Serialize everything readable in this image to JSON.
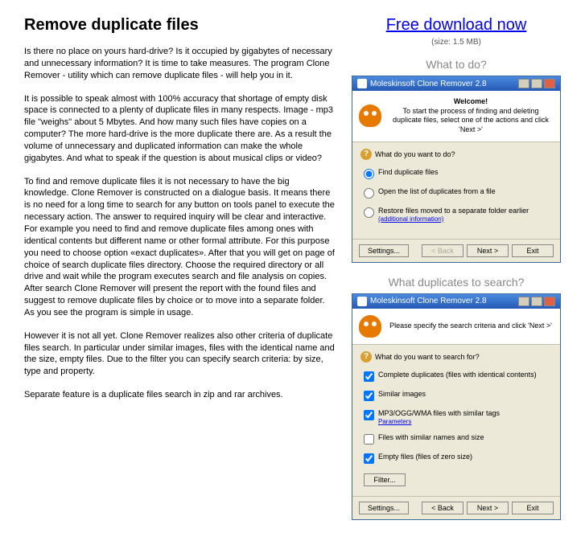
{
  "heading": "Remove duplicate files",
  "paragraphs": [
    "Is there no place on yours hard-drive? Is it occupied by gigabytes of necessary and unnecessary information? It is time to take measures. The program Clone Remover - utility which can remove duplicate files - will help you in it.",
    "It is possible to speak almost with 100% accuracy that shortage of empty disk space is connected to a plenty of duplicate files in many respects. Image - mp3 file \"weighs\" about 5 Mbytes. And how many such files have copies on a computer? The more hard-drive is the more duplicate there are. As a result the volume of unnecessary and duplicated information can make the whole gigabytes. And what to speak if the question is about musical clips or video?",
    "To find and remove duplicate files it is not necessary to have the big knowledge. Clone Remover is constructed on a dialogue basis. It means there is no need for a long time to search for any button on tools panel to execute the necessary action. The answer to required inquiry will be clear and interactive. For example you need to find and remove duplicate files among ones with identical contents but different name or other formal attribute. For this purpose you need to choose option «exact duplicates». After that you will get on page of choice of search duplicate files directory. Choose the required directory or all drive and wait while the program executes search and file analysis on copies. After search Clone Remover will present the report with the found files and suggest to remove duplicate files by choice or to move into a separate folder. As you see the program is simple in usage.",
    "However it is not all yet. Clone Remover realizes also other criteria of duplicate files search. In particular under similar images, files with the identical name and the size, empty files. Due to the filter you can specify search criteria: by size, type and property.",
    "Separate feature is a duplicate files search in zip and rar archives."
  ],
  "download": {
    "label": "Free download now",
    "size": "(size: 1.5 MB)"
  },
  "section1": {
    "title": "What to do?",
    "window_title": "Moleskinsoft Clone Remover 2.8",
    "welcome": "Welcome!",
    "intro": "To start the process of finding and deleting duplicate files, select one of the actions and click 'Next >'",
    "question": "What do you want to do?",
    "opt1": "Find duplicate files",
    "opt2": "Open the list of duplicates from a file",
    "opt3": "Restore files moved to a separate folder earlier",
    "opt3_link": "(additional information)",
    "settings": "Settings...",
    "back": "< Back",
    "next": "Next >",
    "exit": "Exit"
  },
  "section2": {
    "title": "What duplicates to search?",
    "window_title": "Moleskinsoft Clone Remover 2.8",
    "intro": "Please specify the search criteria and click 'Next >'",
    "question": "What do you want to search for?",
    "chk1": "Complete duplicates (files with identical contents)",
    "chk2": "Similar images",
    "chk3": "MP3/OGG/WMA files with similar tags",
    "chk3_link": "Parameters",
    "chk4": "Files with similar names and size",
    "chk5": "Empty files (files of zero size)",
    "filter": "Filter...",
    "settings": "Settings...",
    "back": "< Back",
    "next": "Next >",
    "exit": "Exit"
  }
}
